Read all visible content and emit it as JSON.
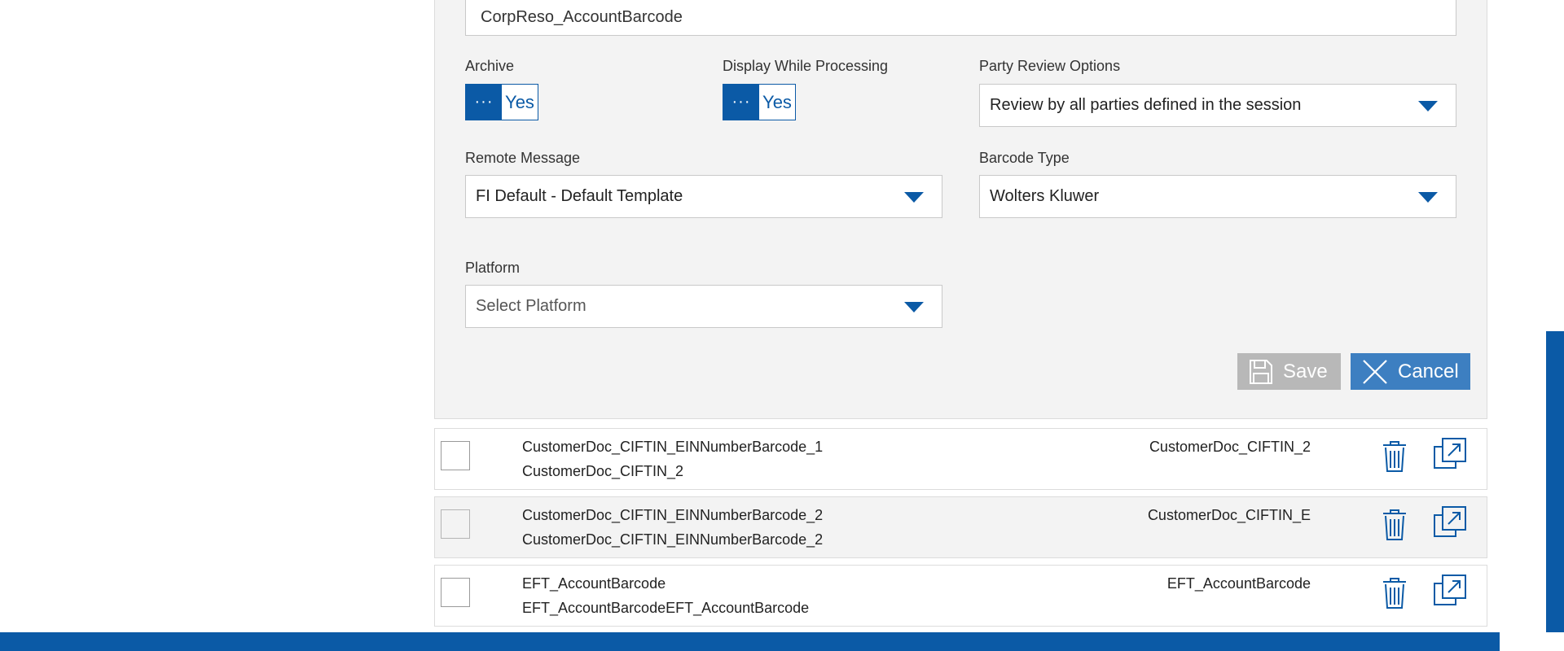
{
  "form": {
    "name_value": "CorpReso_AccountBarcode",
    "archive": {
      "label": "Archive",
      "knob": "···",
      "value": "Yes"
    },
    "display_while_processing": {
      "label": "Display While Processing",
      "knob": "···",
      "value": "Yes"
    },
    "party_review": {
      "label": "Party Review Options",
      "value": "Review by all parties defined in the session"
    },
    "remote_message": {
      "label": "Remote Message",
      "value": "FI Default - Default Template"
    },
    "barcode_type": {
      "label": "Barcode Type",
      "value": "Wolters Kluwer"
    },
    "platform": {
      "label": "Platform",
      "placeholder": "Select Platform"
    },
    "save_label": "Save",
    "cancel_label": "Cancel"
  },
  "rows": [
    {
      "name": "CustomerDoc_CIFTIN_EINNumberBarcode_1",
      "description": "CustomerDoc_CIFTIN_2",
      "document": "CustomerDoc_CIFTIN_2",
      "checked": false
    },
    {
      "name": "CustomerDoc_CIFTIN_EINNumberBarcode_2",
      "description": "CustomerDoc_CIFTIN_EINNumberBarcode_2",
      "document": "CustomerDoc_CIFTIN_E",
      "checked": false
    },
    {
      "name": "EFT_AccountBarcode",
      "description": "EFT_AccountBarcodeEFT_AccountBarcode",
      "document": "EFT_AccountBarcode",
      "checked": false
    }
  ],
  "icons": {
    "toggle_knob": "ellipsis-icon",
    "save": "floppy-disk-icon",
    "cancel": "close-icon",
    "row_delete": "trash-icon",
    "row_open": "open-external-icon",
    "dropdown": "chevron-down-icon"
  },
  "colors": {
    "accent": "#0b5aa6",
    "save_disabled": "#b8b8b8",
    "cancel": "#3d7fc1",
    "panel_bg": "#f3f3f3"
  }
}
